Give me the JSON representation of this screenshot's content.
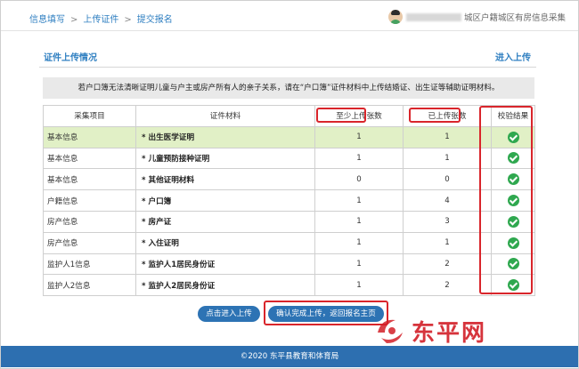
{
  "breadcrumbs": [
    "信息填写",
    "上传证件",
    "提交报名"
  ],
  "breadcrumb_separator": ">",
  "user": {
    "label": "城区户籍城区有房信息采集"
  },
  "section": {
    "title": "证件上传情况",
    "enter_label": "进入上传"
  },
  "notice": "若户口簿无法清晰证明儿童与户主或房产所有人的亲子关系，请在“户口簿”证件材料中上传结婚证、出生证等辅助证明材料。",
  "table": {
    "headers": [
      "采集项目",
      "证件材料",
      "至少上传张数",
      "已上传张数",
      "校验结果"
    ],
    "rows": [
      {
        "project": "基本信息",
        "material": "* 出生医学证明",
        "min": "1",
        "uploaded": "1",
        "highlight": true
      },
      {
        "project": "基本信息",
        "material": "* 儿童预防接种证明",
        "min": "1",
        "uploaded": "1"
      },
      {
        "project": "基本信息",
        "material": "* 其他证明材料",
        "min": "0",
        "uploaded": "0"
      },
      {
        "project": "户籍信息",
        "material": "* 户口簿",
        "min": "1",
        "uploaded": "4"
      },
      {
        "project": "房产信息",
        "material": "* 房产证",
        "min": "1",
        "uploaded": "3"
      },
      {
        "project": "房产信息",
        "material": "* 入住证明",
        "min": "1",
        "uploaded": "1"
      },
      {
        "project": "监护人1信息",
        "material": "* 监护人1居民身份证",
        "min": "1",
        "uploaded": "2"
      },
      {
        "project": "监护人2信息",
        "material": "* 监护人2居民身份证",
        "min": "1",
        "uploaded": "2"
      }
    ]
  },
  "buttons": {
    "upload": "点击进入上传",
    "confirm": "确认完成上传，返回报名主页"
  },
  "footer": "©2020  东平县教育和体育局",
  "watermark": "东平网",
  "colors": {
    "accent": "#2f7fc1",
    "button": "#2d73b4",
    "highlight_row": "#e1f0c6",
    "check": "#2fa84f",
    "annotation": "#d9252b"
  }
}
